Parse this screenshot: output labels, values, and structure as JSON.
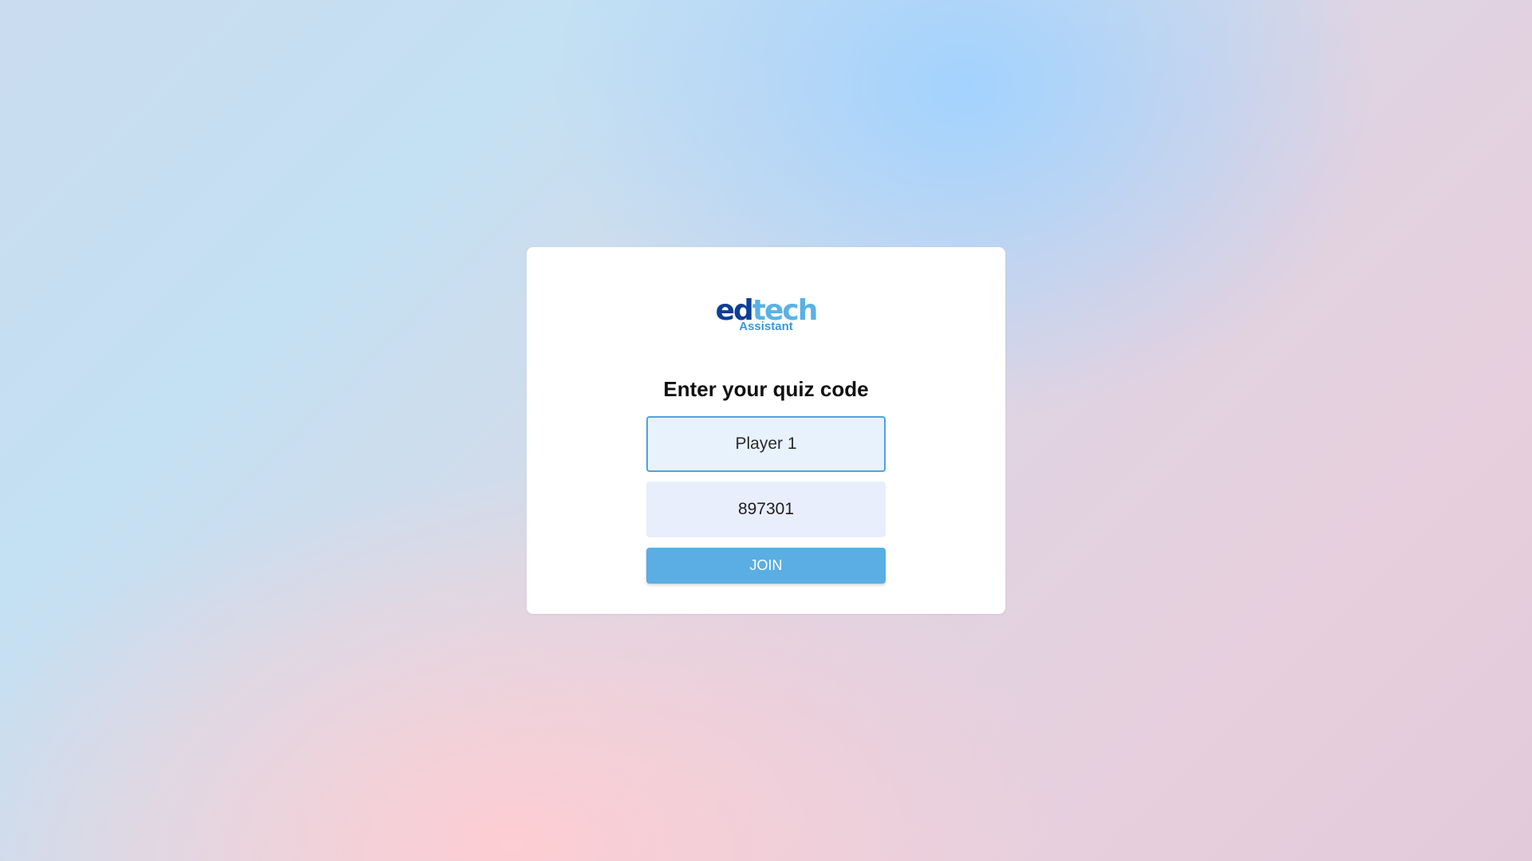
{
  "logo": {
    "part1": "ed",
    "part2": "tech",
    "subtitle": "Assistant"
  },
  "form": {
    "heading": "Enter your quiz code",
    "name_value": "Player 1",
    "code_value": "897301",
    "join_label": "JOIN"
  },
  "colors": {
    "logo_primary": "#0d3e96",
    "logo_secondary": "#5ab1e6",
    "button": "#5aaee3",
    "focused_border": "#4da3dd"
  }
}
